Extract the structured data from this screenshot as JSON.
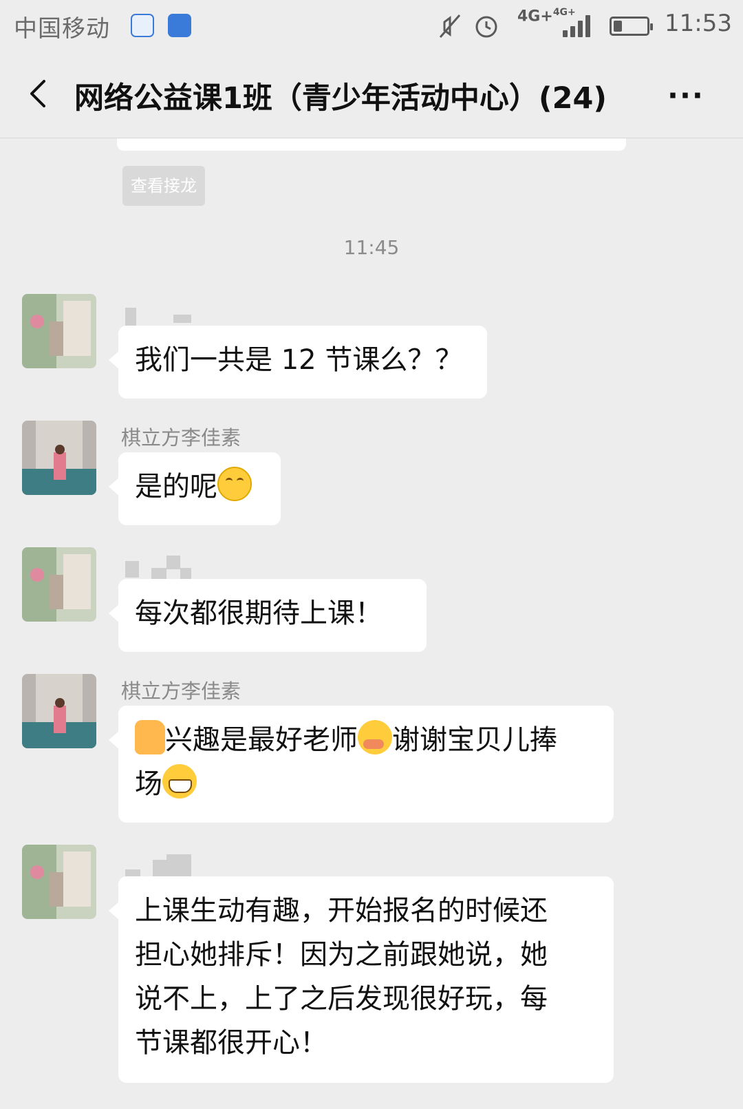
{
  "status_bar": {
    "carrier": "中国移动",
    "network": "4G+",
    "network2": "4G+",
    "time": "11:53",
    "battery_level": 0.25
  },
  "header": {
    "title": "网络公益课1班（青少年活动中心）(24)",
    "more": "···"
  },
  "chat": {
    "view_jielong": "查看接龙",
    "timestamp": "11:45",
    "messages": [
      {
        "sender": "",
        "text": "我们一共是 12 节课么？？"
      },
      {
        "sender": "棋立方李佳素",
        "text": "是的呢"
      },
      {
        "sender": "",
        "text": "每次都很期待上课！"
      },
      {
        "sender": "棋立方李佳素",
        "text_a": "兴趣是最好老师",
        "text_b": "谢谢宝贝儿捧",
        "text_c": "场"
      },
      {
        "sender": "",
        "text_lines": [
          "上课生动有趣，开始报名的时候还",
          "担心她排斥！因为之前跟她说，她",
          "说不上，上了之后发现很好玩，每",
          "节课都很开心！"
        ]
      }
    ]
  },
  "icons": {
    "back": "chevron-left-icon",
    "more": "more-dots-icon",
    "emoji_smile": "smiling-face-emoji",
    "emoji_thumb": "thumbs-up-emoji",
    "emoji_blush": "blushing-face-emoji",
    "emoji_grin": "grinning-face-emoji"
  },
  "colors": {
    "background": "#ededed",
    "bubble": "#ffffff",
    "muted_text": "#8a8a8a"
  }
}
